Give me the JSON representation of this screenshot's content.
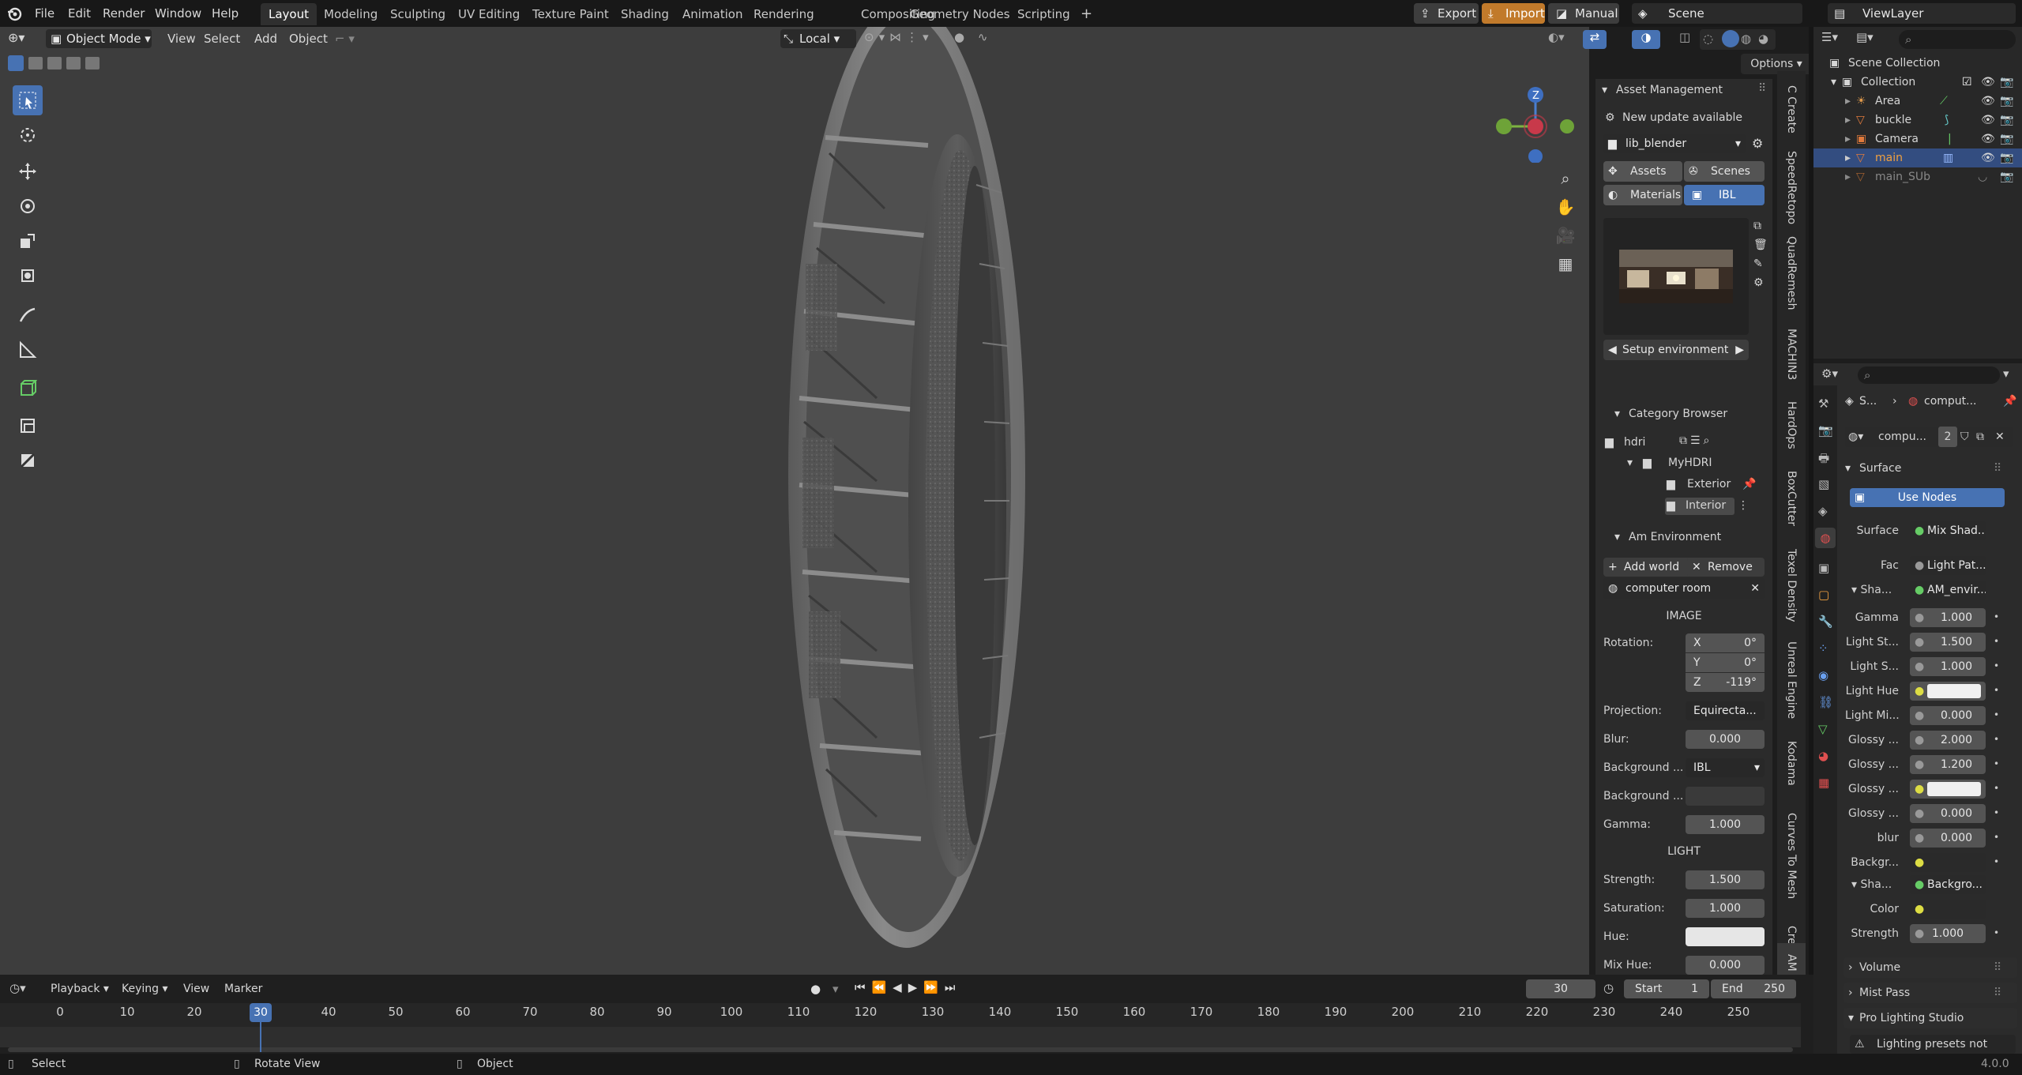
{
  "topbar": {
    "menus": [
      "File",
      "Edit",
      "Render",
      "Window",
      "Help"
    ],
    "workspaces": [
      "Layout",
      "Modeling",
      "Sculpting",
      "UV Editing",
      "Texture Paint",
      "Shading",
      "Animation",
      "Rendering",
      "Compositing",
      "Geometry Nodes",
      "Scripting"
    ],
    "export_label": "Export",
    "import_label": "Import",
    "manual_label": "Manual",
    "scene_name": "Scene",
    "view_layer": "ViewLayer"
  },
  "viewport": {
    "mode": "Object Mode",
    "menus": [
      "View",
      "Select",
      "Add",
      "Object"
    ],
    "transform_orientation": "Local",
    "options_label": "Options",
    "gizmo_z": "Z"
  },
  "asset_panel": {
    "title": "Asset Management",
    "update_notice": "New update available",
    "library": "lib_blender",
    "assets_tab": "Assets",
    "scenes_tab": "Scenes",
    "materials_tab": "Materials",
    "ibl_tab": "IBL",
    "setup_env": "Setup environment",
    "category_title": "Category Browser",
    "categories": {
      "root": "hdri",
      "folder": "MyHDRI",
      "exterior": "Exterior",
      "interior": "Interior"
    },
    "am_env_title": "Am Environment",
    "add_world": "Add world",
    "remove": "Remove",
    "world_name": "computer room",
    "image_header": "IMAGE",
    "rotation_label": "Rotation:",
    "rot_x_label": "X",
    "rot_x": "0°",
    "rot_y_label": "Y",
    "rot_y": "0°",
    "rot_z_label": "Z",
    "rot_z": "-119°",
    "projection_label": "Projection:",
    "projection": "Equirecta...",
    "blur_label": "Blur:",
    "blur": "0.000",
    "bg1_label": "Background ...",
    "bg1": "IBL",
    "bg2_label": "Background ...",
    "gamma_label": "Gamma:",
    "gamma": "1.000",
    "light_header": "LIGHT",
    "strength_label": "Strength:",
    "strength": "1.500",
    "saturation_label": "Saturation:",
    "saturation": "1.000",
    "hue_label": "Hue:",
    "mixhue_label": "Mix Hue:",
    "mixhue": "0.000"
  },
  "side_tabs": [
    "AM",
    "Create",
    "Curves To Mesh",
    "Kodama",
    "Unreal Engine",
    "Texel Density",
    "BoxCutter",
    "HardOps",
    "MACHIN3",
    "QuadRemesh",
    "SpeedRetopo",
    "C Create"
  ],
  "outliner": {
    "scene_collection": "Scene Collection",
    "collection": "Collection",
    "items": [
      "Area",
      "buckle",
      "Camera",
      "main",
      "main_SUb"
    ]
  },
  "properties": {
    "breadcrumb_1": "S...",
    "breadcrumb_2": "comput...",
    "world_name": "compu...",
    "users": "2",
    "surface_header": "Surface",
    "use_nodes": "Use Nodes",
    "surface_label": "Surface",
    "surface_value": "Mix Shad...",
    "fac_label": "Fac",
    "fac_value": "Light Pat...",
    "sha1_label": "Sha...",
    "sha1_value": "AM_envir...",
    "rows": [
      {
        "label": "Gamma",
        "value": "1.000",
        "kind": "num"
      },
      {
        "label": "Light St...",
        "value": "1.500",
        "kind": "num"
      },
      {
        "label": "Light S...",
        "value": "1.000",
        "kind": "num"
      },
      {
        "label": "Light Hue",
        "value": "",
        "kind": "color"
      },
      {
        "label": "Light Mi...",
        "value": "0.000",
        "kind": "num"
      },
      {
        "label": "Glossy ...",
        "value": "2.000",
        "kind": "num"
      },
      {
        "label": "Glossy ...",
        "value": "1.200",
        "kind": "num"
      },
      {
        "label": "Glossy ...",
        "value": "",
        "kind": "color"
      },
      {
        "label": "Glossy ...",
        "value": "0.000",
        "kind": "num"
      },
      {
        "label": "blur",
        "value": "0.000",
        "kind": "num"
      },
      {
        "label": "Backgr...",
        "value": "",
        "kind": "dark"
      }
    ],
    "sha2_label": "Sha...",
    "sha2_value": "Backgro...",
    "color_label": "Color",
    "strength_label": "Strength",
    "strength_value": "1.000",
    "volume": "Volume",
    "mist": "Mist Pass",
    "pro_lighting": "Pro Lighting Studio",
    "presets_note": "Lighting presets not"
  },
  "timeline": {
    "playback": "Playback",
    "keying": "Keying",
    "view": "View",
    "marker": "Marker",
    "current_frame": "30",
    "start_label": "Start",
    "start": "1",
    "end_label": "End",
    "end": "250",
    "ticks": [
      "0",
      "10",
      "20",
      "30",
      "40",
      "50",
      "60",
      "70",
      "80",
      "90",
      "100",
      "110",
      "120",
      "130",
      "140",
      "150",
      "160",
      "170",
      "180",
      "190",
      "200",
      "210",
      "220",
      "230",
      "240",
      "250"
    ]
  },
  "status": {
    "select": "Select",
    "rotate": "Rotate View",
    "object": "Object",
    "version": "4.0.0"
  },
  "colors": {
    "accent": "#4772b3",
    "active_row": "#334d80",
    "panel": "#2b2b2b",
    "viewport": "#3d3d3d",
    "playhead": "#4772b3"
  }
}
